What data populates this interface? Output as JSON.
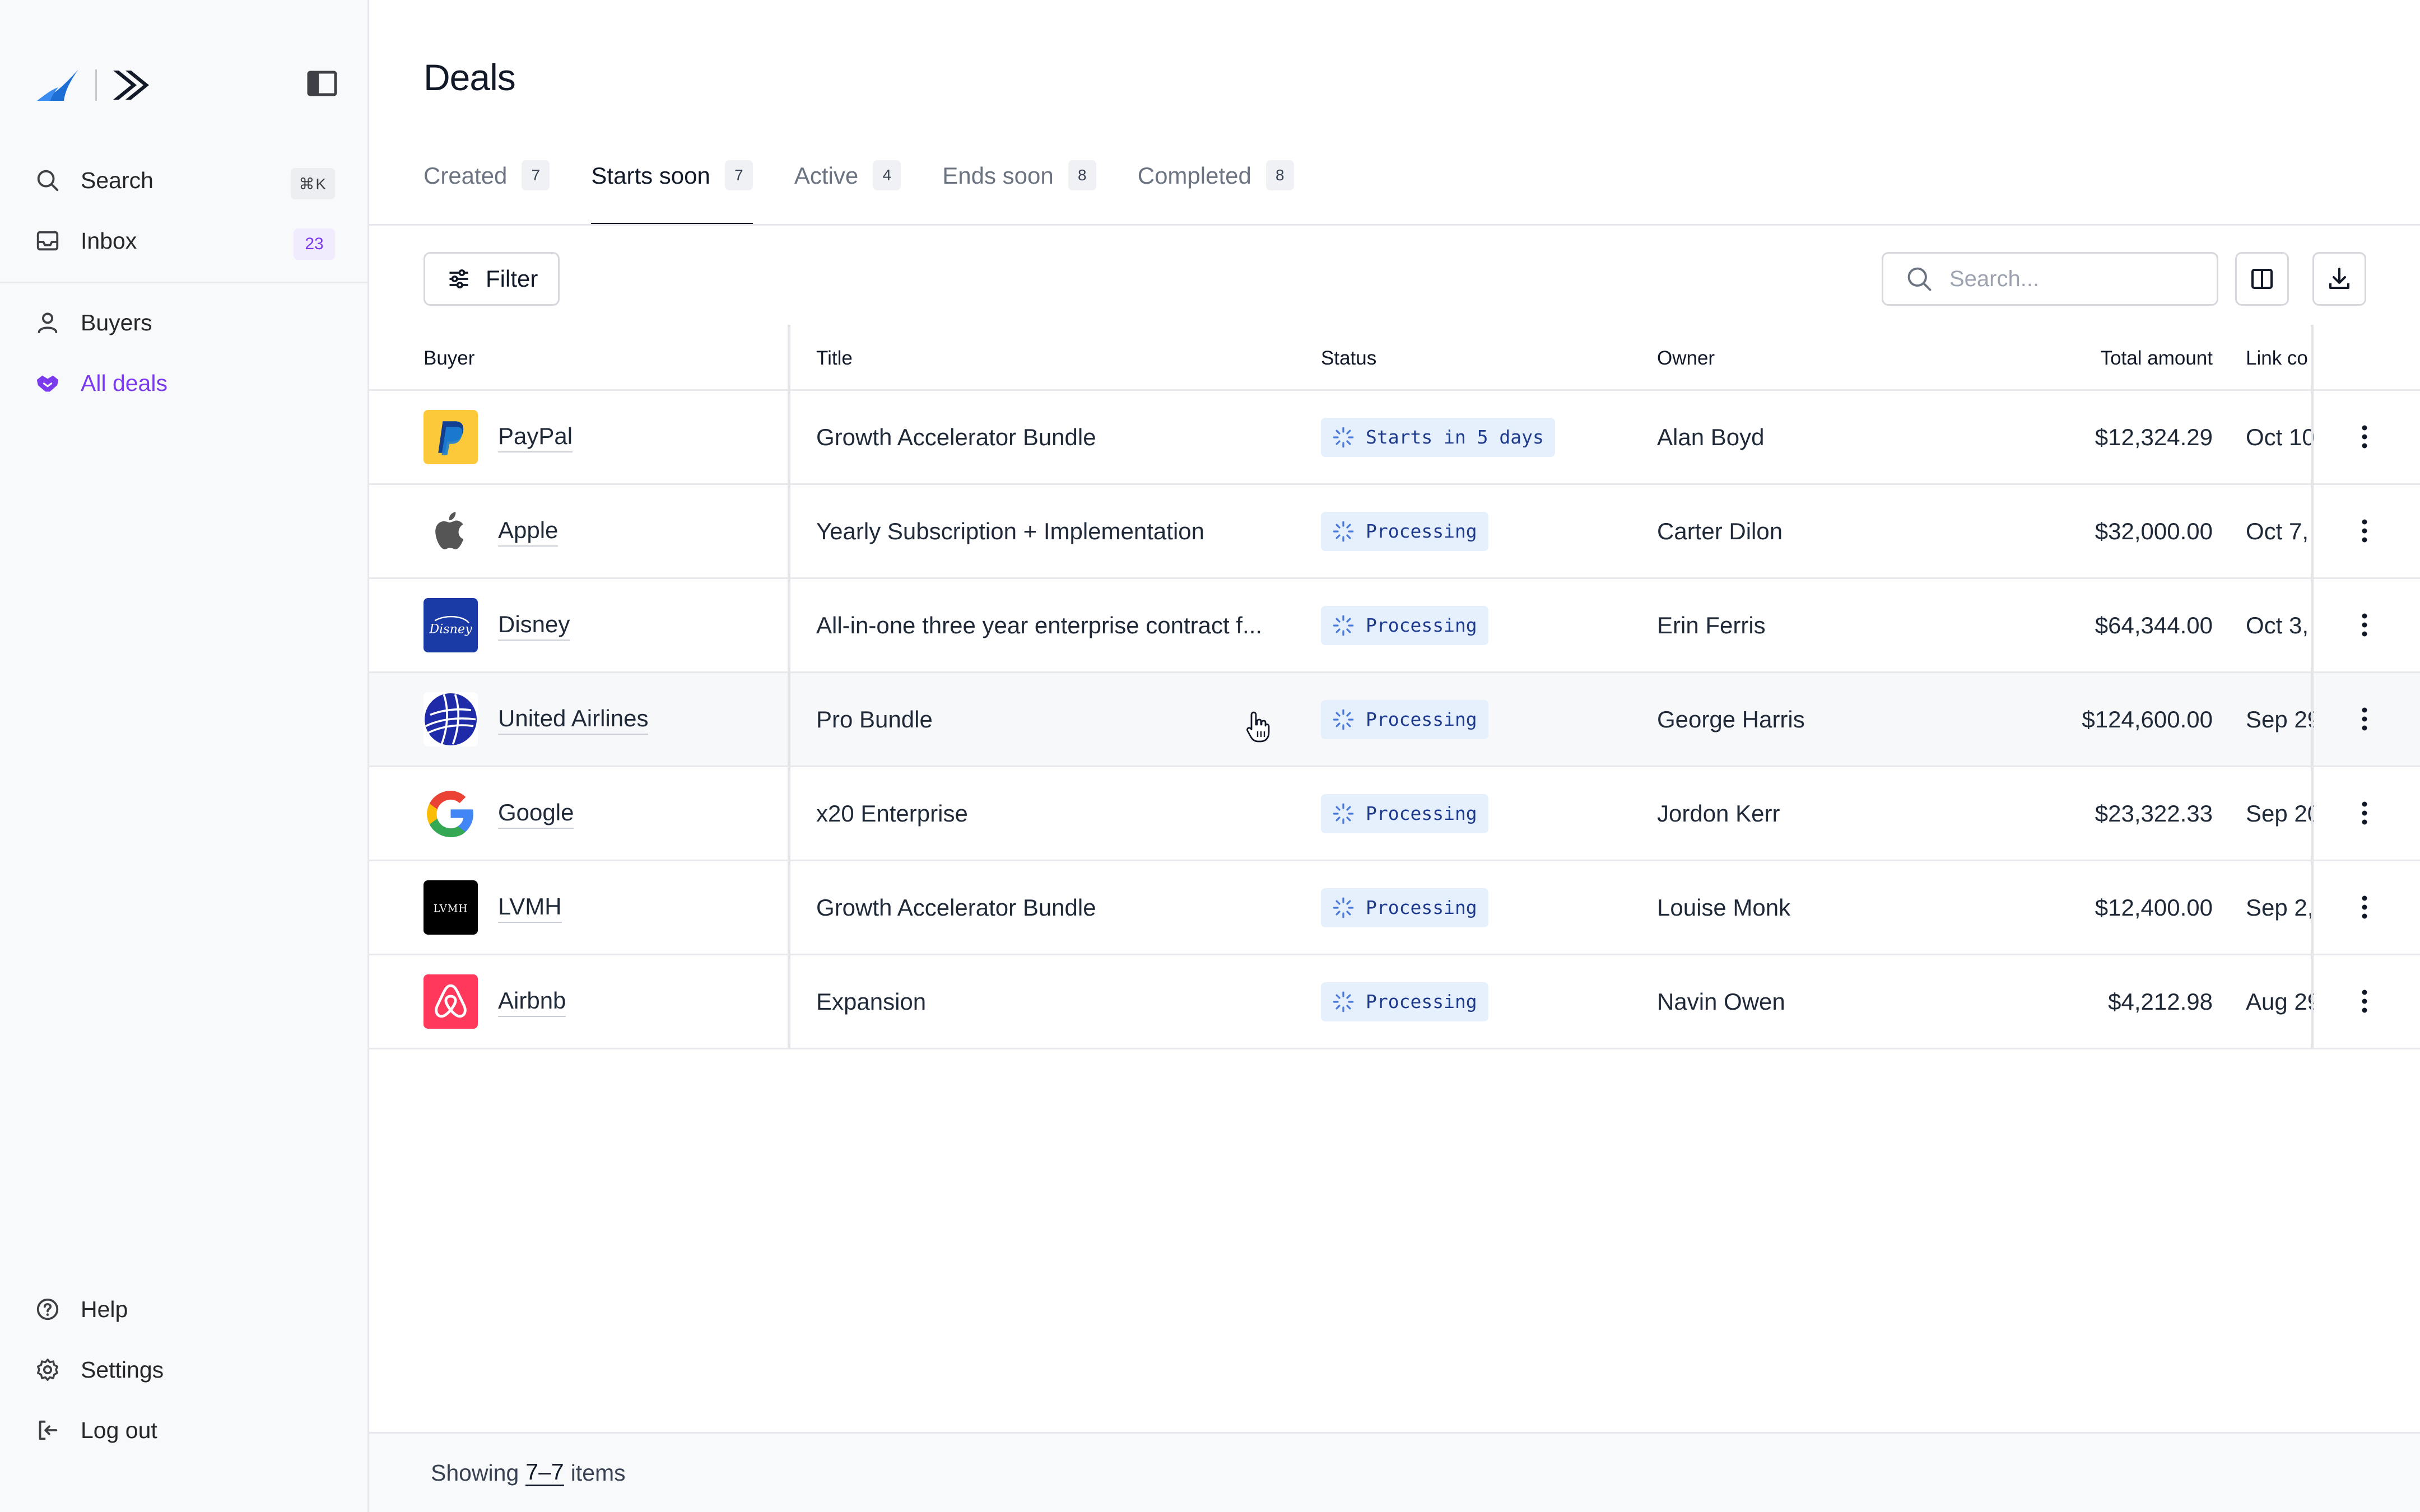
{
  "sidebar": {
    "nav_top": [
      {
        "label": "Search",
        "icon": "search-icon",
        "shortcut": "⌘K"
      },
      {
        "label": "Inbox",
        "icon": "inbox-icon",
        "badge": "23"
      }
    ],
    "nav_main": [
      {
        "label": "Buyers",
        "icon": "user-icon"
      },
      {
        "label": "All deals",
        "icon": "handshake-icon",
        "active": true
      }
    ],
    "nav_bottom": [
      {
        "label": "Help",
        "icon": "help-icon"
      },
      {
        "label": "Settings",
        "icon": "gear-icon"
      },
      {
        "label": "Log out",
        "icon": "logout-icon"
      }
    ]
  },
  "page": {
    "title": "Deals",
    "tabs": [
      {
        "label": "Created",
        "count": "7"
      },
      {
        "label": "Starts soon",
        "count": "7",
        "active": true
      },
      {
        "label": "Active",
        "count": "4"
      },
      {
        "label": "Ends soon",
        "count": "8"
      },
      {
        "label": "Completed",
        "count": "8"
      }
    ],
    "filter_label": "Filter",
    "search_placeholder": "Search..."
  },
  "table": {
    "columns": {
      "buyer": "Buyer",
      "title": "Title",
      "status": "Status",
      "owner": "Owner",
      "amount": "Total amount",
      "link": "Link co"
    },
    "rows": [
      {
        "buyer": "PayPal",
        "logo": "paypal-logo",
        "title": "Growth Accelerator Bundle",
        "status": "Starts in 5 days",
        "owner": "Alan Boyd",
        "amount": "$12,324.29",
        "link": "Oct 10"
      },
      {
        "buyer": "Apple",
        "logo": "apple-logo",
        "title": "Yearly Subscription + Implementation",
        "status": "Processing",
        "owner": "Carter Dilon",
        "amount": "$32,000.00",
        "link": "Oct 7,"
      },
      {
        "buyer": "Disney",
        "logo": "disney-logo",
        "title": "All-in-one three year enterprise contract f...",
        "status": "Processing",
        "owner": "Erin Ferris",
        "amount": "$64,344.00",
        "link": "Oct 3,"
      },
      {
        "buyer": "United Airlines",
        "logo": "united-airlines-logo",
        "title": "Pro Bundle",
        "status": "Processing",
        "owner": "George Harris",
        "amount": "$124,600.00",
        "link": "Sep 29"
      },
      {
        "buyer": "Google",
        "logo": "google-logo",
        "title": "x20 Enterprise",
        "status": "Processing",
        "owner": "Jordon Kerr",
        "amount": "$23,322.33",
        "link": "Sep 20"
      },
      {
        "buyer": "LVMH",
        "logo": "lvmh-logo",
        "title": "Growth Accelerator Bundle",
        "status": "Processing",
        "owner": "Louise Monk",
        "amount": "$12,400.00",
        "link": "Sep 2,"
      },
      {
        "buyer": "Airbnb",
        "logo": "airbnb-logo",
        "title": "Expansion",
        "status": "Processing",
        "owner": "Navin Owen",
        "amount": "$4,212.98",
        "link": "Aug 29"
      }
    ]
  },
  "footer": {
    "prefix": "Showing",
    "range": "7–7",
    "suffix": "items"
  },
  "colors": {
    "accent": "#7c3aed",
    "status_bg": "#e6effc",
    "status_text": "#1e3a8a"
  }
}
